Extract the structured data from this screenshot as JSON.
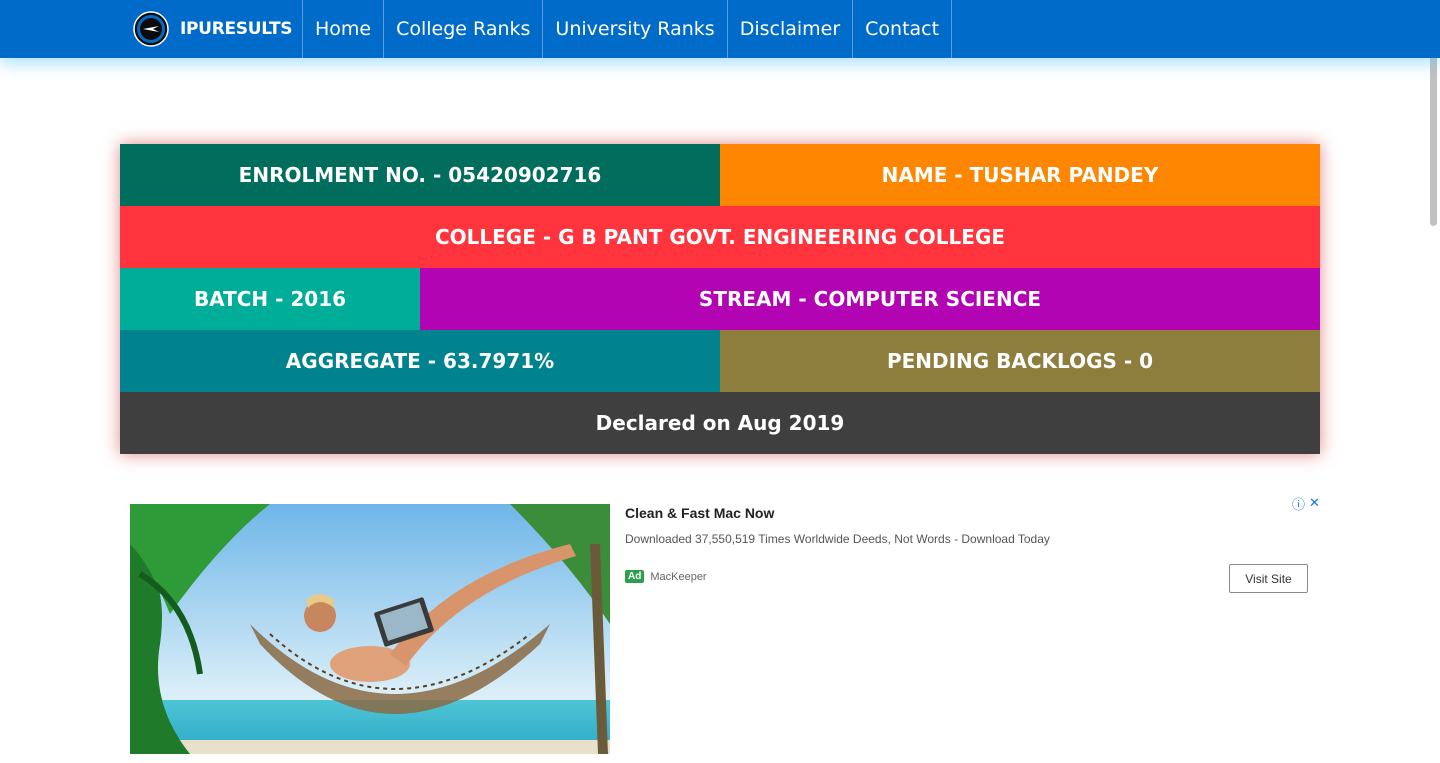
{
  "brand": {
    "name": "IPURESULTS"
  },
  "nav": [
    {
      "label": "Home"
    },
    {
      "label": "College Ranks"
    },
    {
      "label": "University Ranks"
    },
    {
      "label": "Disclaimer"
    },
    {
      "label": "Contact"
    }
  ],
  "result": {
    "enrolment": "ENROLMENT NO. - 05420902716",
    "name": "NAME - TUSHAR PANDEY",
    "college": "COLLEGE - G B PANT GOVT. ENGINEERING COLLEGE",
    "batch": "BATCH - 2016",
    "stream": "STREAM - COMPUTER SCIENCE",
    "aggregate": "AGGREGATE - 63.7971%",
    "backlogs": "PENDING BACKLOGS - 0",
    "declared": "Declared on Aug 2019"
  },
  "colors": {
    "navbar": "#006bc8",
    "enrolment": "#016e5d",
    "name": "#ff8600",
    "college": "#ff343c",
    "batch": "#00ad99",
    "stream": "#b204b3",
    "aggregate": "#00838f",
    "backlogs": "#8e7e3e",
    "declared": "#3f3f3f"
  },
  "ad": {
    "title": "Clean & Fast Mac Now",
    "description": "Downloaded 37,550,519 Times Worldwide Deeds, Not Words - Download Today",
    "badge": "Ad",
    "advertiser": "MacKeeper",
    "cta": "Visit Site",
    "info_icon": "ⓘ",
    "close_icon": "✕"
  }
}
